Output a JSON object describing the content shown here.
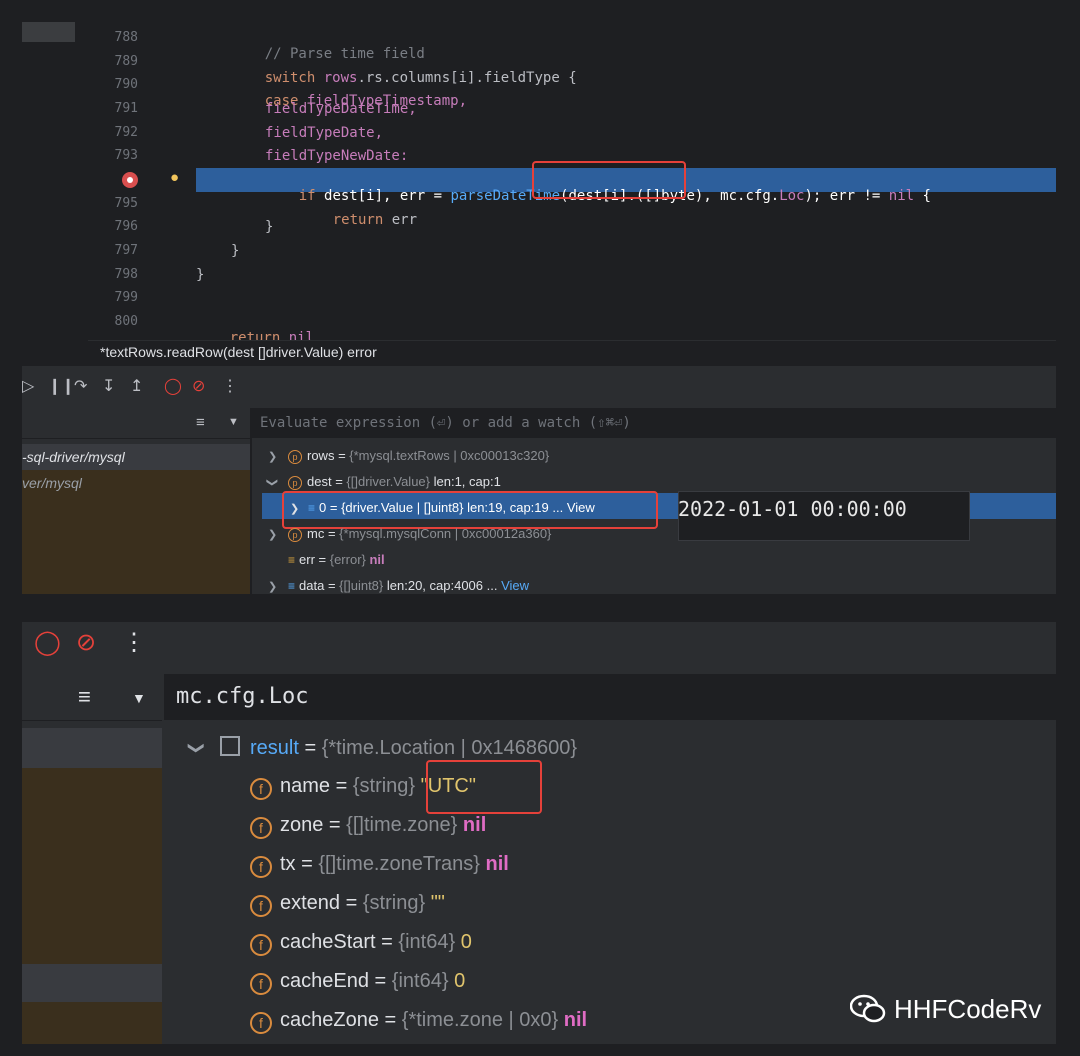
{
  "editor": {
    "lines": [
      {
        "num": "788"
      },
      {
        "num": "789"
      },
      {
        "num": "790"
      },
      {
        "num": "791"
      },
      {
        "num": "792"
      },
      {
        "num": "793"
      },
      {
        "num": ""
      },
      {
        "num": "795"
      },
      {
        "num": "796"
      },
      {
        "num": "797"
      },
      {
        "num": "798"
      },
      {
        "num": "799"
      },
      {
        "num": "800"
      }
    ],
    "code": {
      "l788": "// Parse time field",
      "l789a": "switch ",
      "l789b": "rows",
      "l789c": ".rs.columns[",
      "l789d": "i",
      "l789e": "].fieldType {",
      "l790a": "case ",
      "l790b": "fieldTypeTimestamp,",
      "l791": "fieldTypeDateTime,",
      "l792": "fieldTypeDate,",
      "l793": "fieldTypeNewDate:",
      "l794a": "if ",
      "l794b": "dest[i], err = ",
      "l794c": "parseDateTime",
      "l794d": "(dest[i].([]byte), mc.cfg.",
      "l794e": "Loc",
      "l794f": "); err != ",
      "l794g": "nil",
      "l794h": " {",
      "l795a": "return ",
      "l795b": "err",
      "l796": "}",
      "l797": "}",
      "l798": "}",
      "l800a": "return ",
      "l800b": "nil"
    },
    "status": "*textRows.readRow(dest []driver.Value) error"
  },
  "debugger": {
    "eval_placeholder": "Evaluate expression (⏎) or add a watch (⇧⌘⏎)",
    "frames": [
      "-sql-driver/mysql",
      "ver/mysql"
    ],
    "variables": [
      {
        "name": "rows",
        "eq": " = ",
        "type": "{*mysql.textRows | 0xc00013c320}"
      },
      {
        "name": "dest",
        "eq": " = ",
        "type": "{[]driver.Value}",
        "extra": " len:1, cap:1"
      },
      {
        "name": "0",
        "eq": " = ",
        "value": "{driver.Value | []uint8} len:19, cap:19 ... ",
        "link": "View"
      },
      {
        "name": "mc",
        "eq": " = ",
        "type": "{*mysql.mysqlConn | 0xc00012a360}"
      },
      {
        "name": "err",
        "eq": " = ",
        "type": "{error} ",
        "nil": "nil"
      },
      {
        "name": "data",
        "eq": " = ",
        "type": "{[]uint8}",
        "extra": " len:20, cap:4006 ... ",
        "link": "View"
      }
    ],
    "tooltip": "2022-01-01 00:00:00"
  },
  "eval_panel": {
    "expression": "mc.cfg.Loc",
    "result": {
      "name": "result",
      "eq": " = ",
      "type": "{*time.Location | 0x1468600}"
    },
    "fields": [
      {
        "name": "name",
        "type": "{string} ",
        "value": "\"UTC\""
      },
      {
        "name": "zone",
        "type": "{[]time.zone} ",
        "value": "nil"
      },
      {
        "name": "tx",
        "type": "{[]time.zoneTrans} ",
        "value": "nil"
      },
      {
        "name": "extend",
        "type": "{string} ",
        "value": "\"\""
      },
      {
        "name": "cacheStart",
        "type": "{int64} ",
        "value": "0"
      },
      {
        "name": "cacheEnd",
        "type": "{int64} ",
        "value": "0"
      },
      {
        "name": "cacheZone",
        "type": "{*time.zone | 0x0} ",
        "value": "nil"
      }
    ]
  },
  "watermark": "HHFCodeRv",
  "colors": {
    "highlight": "#2d5f9c",
    "redbox": "#e5413a",
    "keyword": "#cf8e6d",
    "function": "#57aaf7"
  }
}
